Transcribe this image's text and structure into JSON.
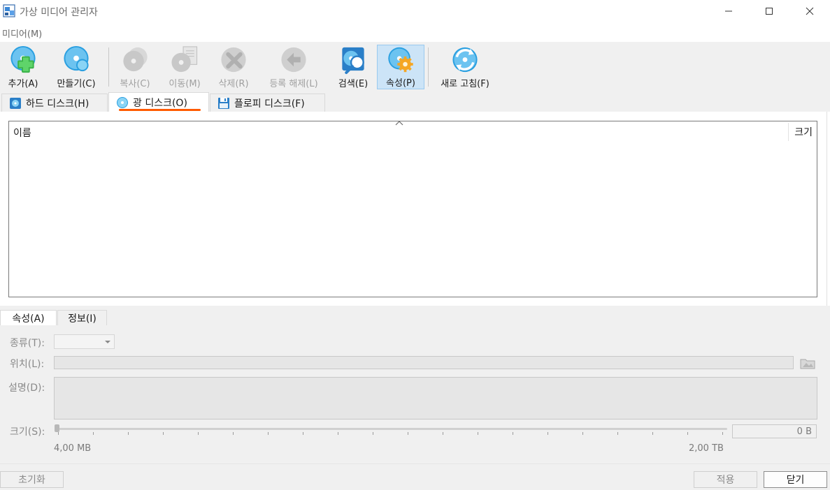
{
  "window": {
    "title": "가상 미디어 관리자"
  },
  "menu": {
    "media_label": "미디어(M)"
  },
  "toolbar": {
    "add": "추가(A)",
    "create": "만들기(C)",
    "copy": "복사(C)",
    "move": "이동(M)",
    "remove": "삭제(R)",
    "release": "등록 해제(L)",
    "search": "검색(E)",
    "properties": "속성(P)",
    "refresh": "새로 고침(F)"
  },
  "media_tabs": {
    "hard_disk": "하드 디스크(H)",
    "optical_disk": "광 디스크(O)",
    "floppy_disk": "플로피 디스크(F)",
    "selected": "optical_disk"
  },
  "list": {
    "col_name": "이름",
    "col_size": "크기",
    "rows": []
  },
  "details": {
    "tab_attributes": "속성(A)",
    "tab_info": "정보(I)",
    "type_label": "종류(T):",
    "location_label": "위치(L):",
    "description_label": "설명(D):",
    "size_label": "크기(S):",
    "size_value": "0 B",
    "size_min": "4,00 MB",
    "size_max": "2,00 TB"
  },
  "footer": {
    "reset": "초기화",
    "apply": "적용",
    "close": "닫기"
  },
  "colors": {
    "accent": "#ff5a00",
    "selection": "#cce4f7",
    "disc_blue": "#2a9fe0"
  }
}
